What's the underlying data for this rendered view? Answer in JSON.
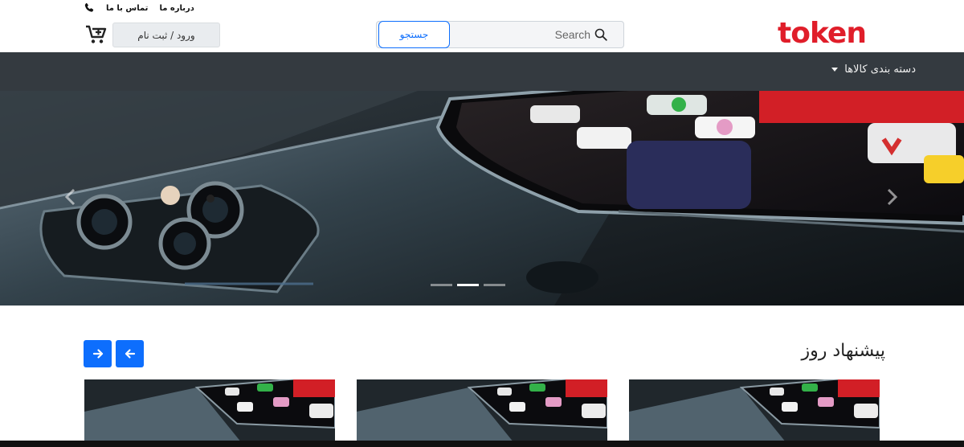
{
  "header": {
    "top_links": [
      {
        "label": "درباره ما"
      },
      {
        "label": "تماس با ما"
      }
    ],
    "login_label": "ورود / ثبت نام",
    "search": {
      "button_label": "جستجو",
      "placeholder": "Search"
    },
    "logo_text": "token"
  },
  "navbar": {
    "categories_label": "دسته بندی کالاها"
  },
  "hero": {
    "slide_count": 3,
    "active_slide": 2
  },
  "section": {
    "title": "پیشنهاد روز"
  },
  "colors": {
    "brand": "#e01e2a",
    "navbar": "#343a40",
    "primary": "#0d6efd"
  },
  "icons": [
    "phone-icon",
    "cart-icon",
    "search-icon",
    "chevron-left-icon",
    "chevron-right-icon",
    "arrow-right-icon",
    "arrow-left-icon"
  ]
}
